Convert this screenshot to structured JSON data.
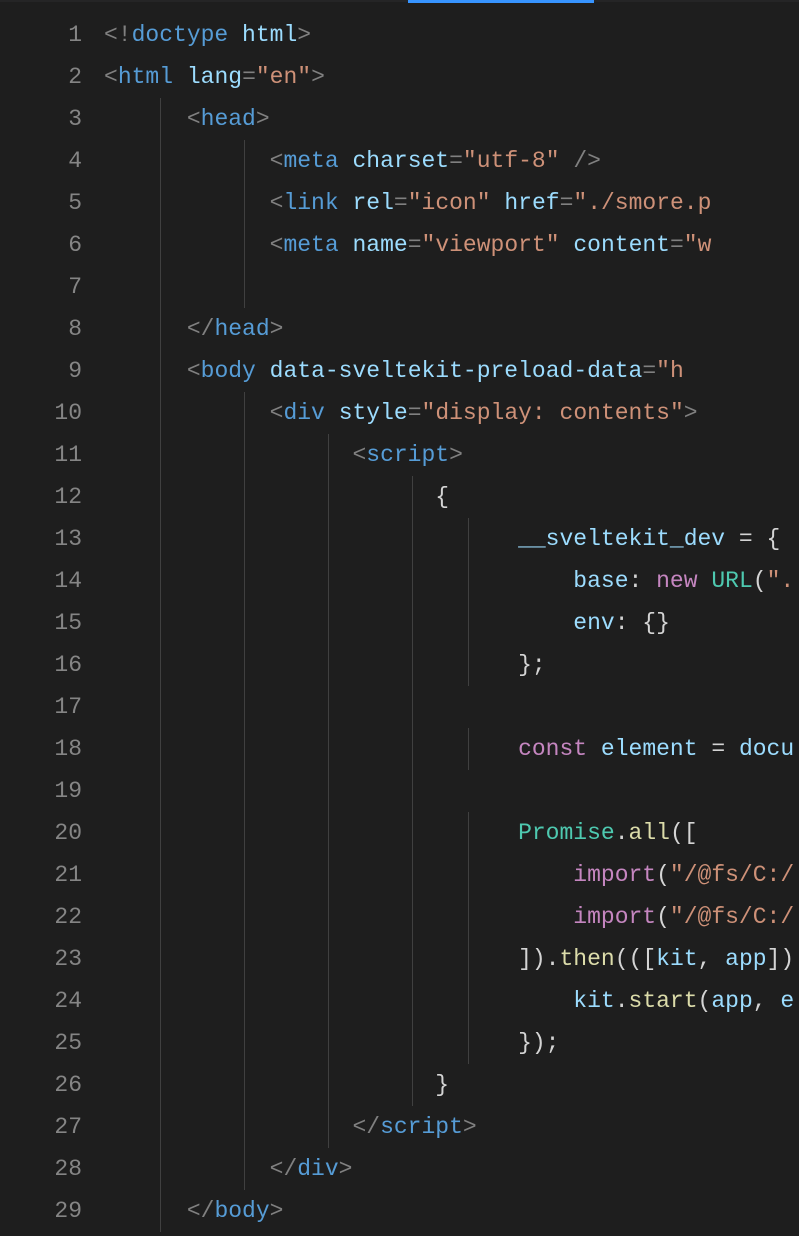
{
  "lineCount": 29,
  "code": {
    "doctype": "doctype",
    "htmlWord": "html",
    "htmlTag": "html",
    "langAttr": "lang",
    "langVal": "\"en\"",
    "head": "head",
    "meta": "meta",
    "charset": "charset",
    "charsetVal": "\"utf-8\"",
    "link": "link",
    "rel": "rel",
    "relVal": "\"icon\"",
    "href": "href",
    "hrefVal": "\"./smore.p",
    "name": "name",
    "nameVal": "\"viewport\"",
    "content": "content",
    "contentVal": "\"w",
    "body": "body",
    "dataPreload": "data-sveltekit-preload-data",
    "dataPreloadVal": "\"h",
    "div": "div",
    "style": "style",
    "styleVal": "\"display: contents\"",
    "script": "script",
    "svelteDev": "__sveltekit_dev",
    "base": "base",
    "newKw": "new",
    "urlCls": "URL",
    "urlArg": "\".",
    "env": "env",
    "constKw": "const",
    "element": "element",
    "docu": "docu",
    "promise": "Promise",
    "all": "all",
    "importKw": "import",
    "importArg": "\"/@fs/C:/",
    "then": "then",
    "kit": "kit",
    "app": "app",
    "start": "start",
    "e": "e"
  }
}
